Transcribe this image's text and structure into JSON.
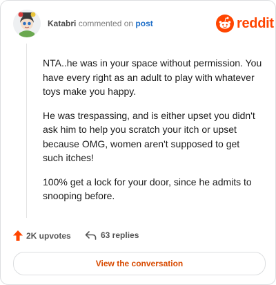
{
  "header": {
    "username": "Katabri",
    "action_text": "commented on",
    "post_link_label": "post",
    "brand_name": "reddit",
    "brand_color": "#ff4500"
  },
  "comment": {
    "paragraphs": [
      "NTA..he was in your space without permission. You have every right as an adult to play with whatever toys make you happy.",
      "He was trespassing, and is either upset you didn't ask him to help you scratch your itch or upset because OMG, women aren't supposed to get such itches!",
      "100% get a lock for your door, since he admits to snooping before."
    ]
  },
  "footer": {
    "upvotes_label": "2K upvotes",
    "replies_label": "63 replies",
    "cta_label": "View the conversation",
    "upvote_icon": "upvote-arrow-icon",
    "reply_icon": "reply-arrow-icon",
    "accent_color": "#d84a00"
  }
}
